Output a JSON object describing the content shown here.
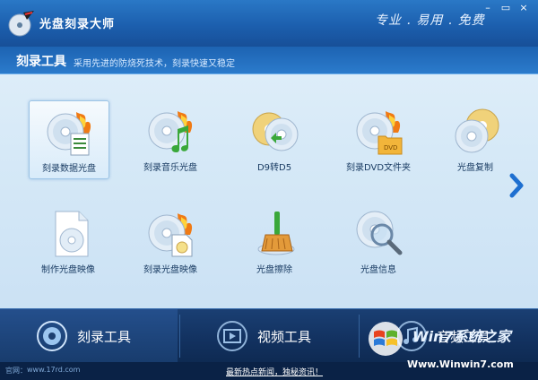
{
  "window": {
    "title": "光盘刻录大师",
    "slogan": "专业 . 易用 . 免费",
    "controls": {
      "minimize": "–",
      "maximize": "▭",
      "close": "×"
    }
  },
  "section": {
    "title": "刻录工具",
    "description": "采用先进的防烧死技术，刻录快速又稳定"
  },
  "tools": [
    {
      "label": "刻录数据光盘",
      "icon": "data-disc-burn-icon",
      "selected": true
    },
    {
      "label": "刻录音乐光盘",
      "icon": "music-disc-burn-icon"
    },
    {
      "label": "D9转D5",
      "icon": "d9-to-d5-icon"
    },
    {
      "label": "刻录DVD文件夹",
      "icon": "dvd-folder-burn-icon"
    },
    {
      "label": "光盘复制",
      "icon": "disc-copy-icon"
    },
    {
      "label": "制作光盘映像",
      "icon": "make-disc-image-icon"
    },
    {
      "label": "刻录光盘映像",
      "icon": "burn-disc-image-icon"
    },
    {
      "label": "光盘擦除",
      "icon": "disc-erase-icon"
    },
    {
      "label": "光盘信息",
      "icon": "disc-info-icon"
    }
  ],
  "tabs": [
    {
      "label": "刻录工具",
      "icon": "disc-icon",
      "active": true
    },
    {
      "label": "视频工具",
      "icon": "film-icon"
    },
    {
      "label": "音频工具",
      "icon": "music-note-icon"
    }
  ],
  "status": {
    "site_label": "官网：",
    "site_value": "www.17rd.com",
    "news": "最新热点新闻，独秘资讯！"
  },
  "watermark": {
    "line1": "Win7系统之家",
    "line2": "Www.Winwin7.com"
  },
  "colors": {
    "titlebar": "#1c5fae",
    "content_bg": "#d6e9f7",
    "tabbar": "#12315f",
    "label_text": "#1a3c63",
    "flame": "#f07a14"
  }
}
